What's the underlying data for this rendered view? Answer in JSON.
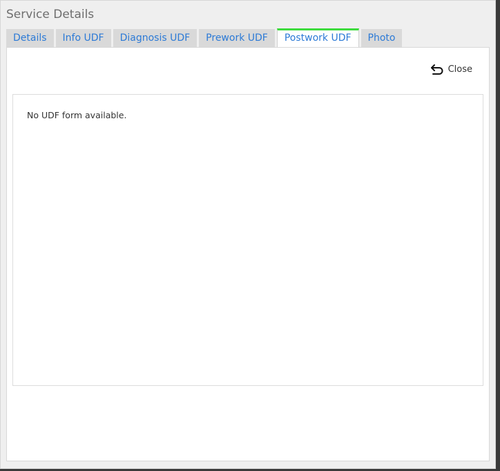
{
  "dialog": {
    "title": "Service Details"
  },
  "tabs": [
    {
      "label": "Details",
      "active": false
    },
    {
      "label": "Info UDF",
      "active": false
    },
    {
      "label": "Diagnosis UDF",
      "active": false
    },
    {
      "label": "Prework UDF",
      "active": false
    },
    {
      "label": "Postwork UDF",
      "active": true
    },
    {
      "label": "Photo",
      "active": false
    }
  ],
  "toolbar": {
    "close_label": "Close",
    "close_icon": "undo-arrow-icon"
  },
  "content": {
    "message": "No UDF form available."
  },
  "colors": {
    "tab_text": "#2c7ad6",
    "active_tab_accent": "#3ddc3d",
    "tab_bg": "#d9d9d9"
  }
}
